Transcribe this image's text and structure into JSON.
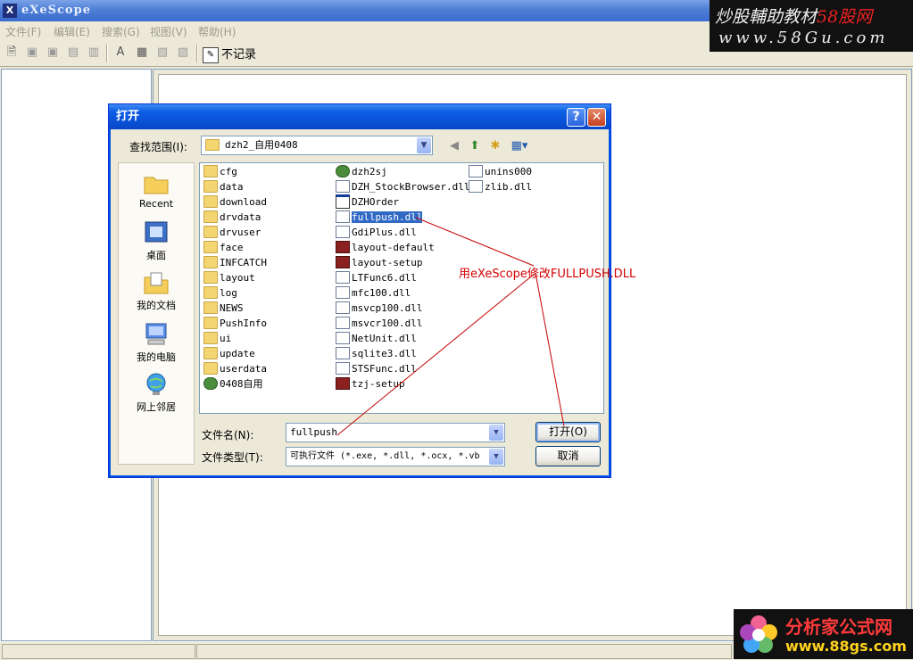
{
  "app": {
    "title": "eXeScope"
  },
  "menu": [
    "文件(F)",
    "编辑(E)",
    "搜索(G)",
    "视图(V)",
    "帮助(H)"
  ],
  "toolbar": {
    "nolog_label": "不记录"
  },
  "dialog": {
    "title": "打开",
    "lookin_label": "查找范围(I):",
    "lookin_value": "dzh2_自用0408",
    "places": [
      "Recent",
      "桌面",
      "我的文档",
      "我的电脑",
      "网上邻居"
    ],
    "files": [
      {
        "name": "cfg",
        "type": "folder"
      },
      {
        "name": "data",
        "type": "folder"
      },
      {
        "name": "download",
        "type": "folder"
      },
      {
        "name": "drvdata",
        "type": "folder"
      },
      {
        "name": "drvuser",
        "type": "folder"
      },
      {
        "name": "face",
        "type": "folder"
      },
      {
        "name": "INFCATCH",
        "type": "folder"
      },
      {
        "name": "layout",
        "type": "folder"
      },
      {
        "name": "log",
        "type": "folder"
      },
      {
        "name": "NEWS",
        "type": "folder"
      },
      {
        "name": "PushInfo",
        "type": "folder"
      },
      {
        "name": "ui",
        "type": "folder"
      },
      {
        "name": "update",
        "type": "folder"
      },
      {
        "name": "userdata",
        "type": "folder"
      },
      {
        "name": "0408自用",
        "type": "exe"
      },
      {
        "name": "dzh2sj",
        "type": "exe"
      },
      {
        "name": "DZH_StockBrowser.dll",
        "type": "dll"
      },
      {
        "name": "DZHOrder",
        "type": "dlg"
      },
      {
        "name": "fullpush.dll",
        "type": "dll",
        "selected": true
      },
      {
        "name": "GdiPlus.dll",
        "type": "dll"
      },
      {
        "name": "layout-default",
        "type": "app"
      },
      {
        "name": "layout-setup",
        "type": "app"
      },
      {
        "name": "LTFunc6.dll",
        "type": "dll"
      },
      {
        "name": "mfc100.dll",
        "type": "dll"
      },
      {
        "name": "msvcp100.dll",
        "type": "dll"
      },
      {
        "name": "msvcr100.dll",
        "type": "dll"
      },
      {
        "name": "NetUnit.dll",
        "type": "dll"
      },
      {
        "name": "sqlite3.dll",
        "type": "dll"
      },
      {
        "name": "STSFunc.dll",
        "type": "dll"
      },
      {
        "name": "tzj-setup",
        "type": "app"
      },
      {
        "name": "unins000",
        "type": "dll"
      },
      {
        "name": "zlib.dll",
        "type": "dll"
      }
    ],
    "filename_label": "文件名(N):",
    "filename_value": "fullpush",
    "filetype_label": "文件类型(T):",
    "filetype_value": "可执行文件 (*.exe, *.dll, *.ocx, *.vb",
    "open_button": "打开(O)",
    "cancel_button": "取消"
  },
  "annotation": "用eXeScope修改FULLPUSH.DLL",
  "watermark_top": {
    "line1_a": "炒股輔助教材",
    "line1_b": "58股网",
    "line2": "www.58Gu.com"
  },
  "watermark_bottom": {
    "line1": "分析家公式网",
    "line2": "www.88gs.com"
  },
  "colors": {
    "title_blue": "#0a51d6",
    "selection": "#316ac5",
    "annotation_red": "#d40000"
  }
}
